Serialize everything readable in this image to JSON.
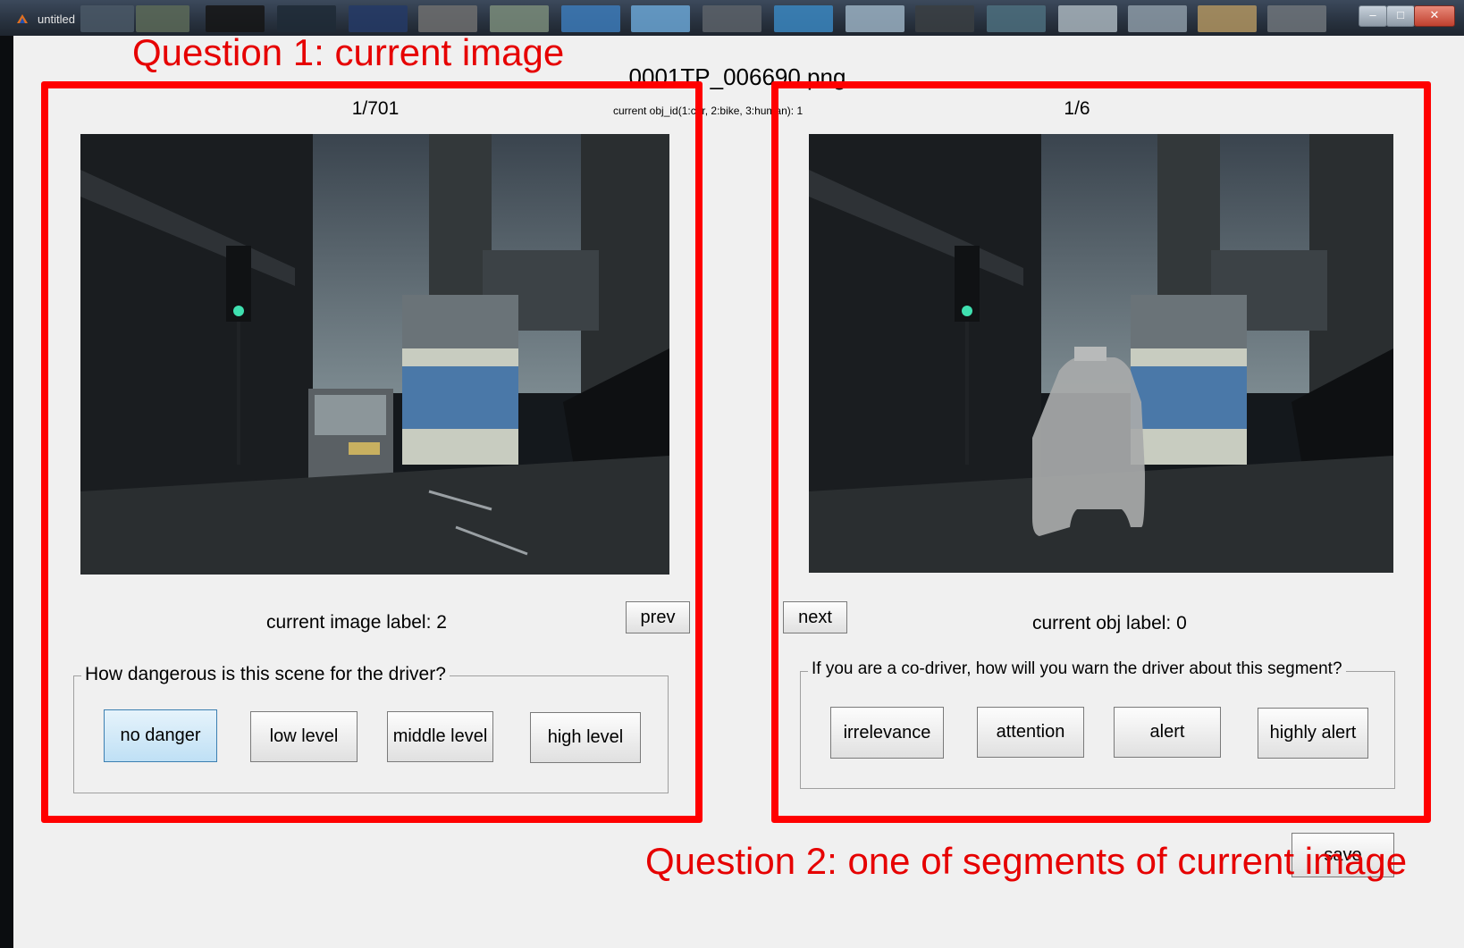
{
  "window": {
    "title": "untitled",
    "controls": {
      "minimize": "–",
      "maximize": "□",
      "close": "✕"
    }
  },
  "header": {
    "filename": "0001TP_006690.png",
    "obj_hint": "current obj_id(1:car, 2:bike, 3:human): 1"
  },
  "left_panel": {
    "counter": "1/701",
    "image_label": "current image label: 2",
    "group_title": "How dangerous is this scene for the driver?",
    "buttons": [
      "no danger",
      "low level",
      "middle level",
      "high level"
    ],
    "active_button": "no danger",
    "prev_label": "prev"
  },
  "right_panel": {
    "counter": "1/6",
    "obj_label": "current obj label: 0",
    "group_title": "If you are a co-driver, how will you warn the driver about this segment?",
    "buttons": [
      "irrelevance",
      "attention",
      "alert",
      "highly alert"
    ],
    "next_label": "next"
  },
  "save_label": "save",
  "annotations": {
    "q1": "Question 1: current image",
    "q2": "Question 2: one of segments of current image"
  }
}
